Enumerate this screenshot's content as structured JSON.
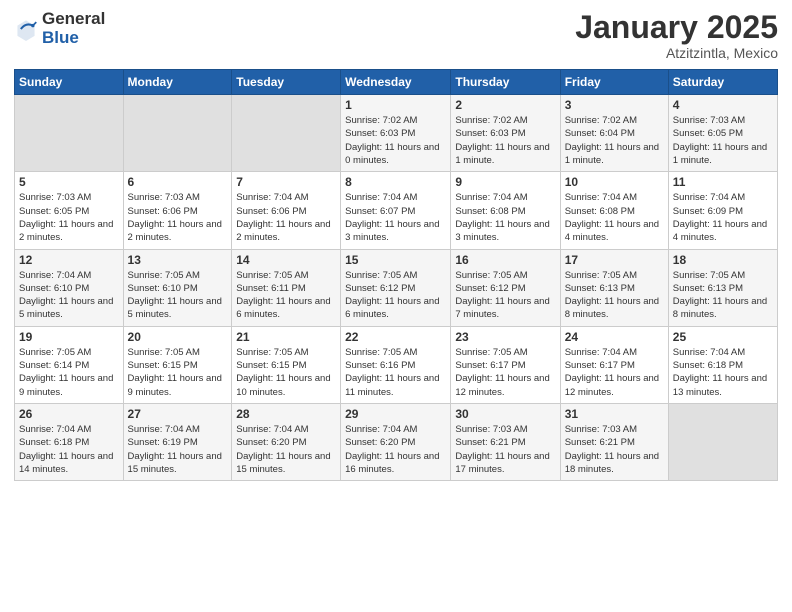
{
  "logo": {
    "general": "General",
    "blue": "Blue"
  },
  "title": "January 2025",
  "location": "Atzitzintla, Mexico",
  "days_of_week": [
    "Sunday",
    "Monday",
    "Tuesday",
    "Wednesday",
    "Thursday",
    "Friday",
    "Saturday"
  ],
  "weeks": [
    [
      null,
      null,
      null,
      {
        "day": 1,
        "sunrise": "7:02 AM",
        "sunset": "6:03 PM",
        "daylight": "11 hours and 0 minutes."
      },
      {
        "day": 2,
        "sunrise": "7:02 AM",
        "sunset": "6:03 PM",
        "daylight": "11 hours and 1 minute."
      },
      {
        "day": 3,
        "sunrise": "7:02 AM",
        "sunset": "6:04 PM",
        "daylight": "11 hours and 1 minute."
      },
      {
        "day": 4,
        "sunrise": "7:03 AM",
        "sunset": "6:05 PM",
        "daylight": "11 hours and 1 minute."
      }
    ],
    [
      {
        "day": 5,
        "sunrise": "7:03 AM",
        "sunset": "6:05 PM",
        "daylight": "11 hours and 2 minutes."
      },
      {
        "day": 6,
        "sunrise": "7:03 AM",
        "sunset": "6:06 PM",
        "daylight": "11 hours and 2 minutes."
      },
      {
        "day": 7,
        "sunrise": "7:04 AM",
        "sunset": "6:06 PM",
        "daylight": "11 hours and 2 minutes."
      },
      {
        "day": 8,
        "sunrise": "7:04 AM",
        "sunset": "6:07 PM",
        "daylight": "11 hours and 3 minutes."
      },
      {
        "day": 9,
        "sunrise": "7:04 AM",
        "sunset": "6:08 PM",
        "daylight": "11 hours and 3 minutes."
      },
      {
        "day": 10,
        "sunrise": "7:04 AM",
        "sunset": "6:08 PM",
        "daylight": "11 hours and 4 minutes."
      },
      {
        "day": 11,
        "sunrise": "7:04 AM",
        "sunset": "6:09 PM",
        "daylight": "11 hours and 4 minutes."
      }
    ],
    [
      {
        "day": 12,
        "sunrise": "7:04 AM",
        "sunset": "6:10 PM",
        "daylight": "11 hours and 5 minutes."
      },
      {
        "day": 13,
        "sunrise": "7:05 AM",
        "sunset": "6:10 PM",
        "daylight": "11 hours and 5 minutes."
      },
      {
        "day": 14,
        "sunrise": "7:05 AM",
        "sunset": "6:11 PM",
        "daylight": "11 hours and 6 minutes."
      },
      {
        "day": 15,
        "sunrise": "7:05 AM",
        "sunset": "6:12 PM",
        "daylight": "11 hours and 6 minutes."
      },
      {
        "day": 16,
        "sunrise": "7:05 AM",
        "sunset": "6:12 PM",
        "daylight": "11 hours and 7 minutes."
      },
      {
        "day": 17,
        "sunrise": "7:05 AM",
        "sunset": "6:13 PM",
        "daylight": "11 hours and 8 minutes."
      },
      {
        "day": 18,
        "sunrise": "7:05 AM",
        "sunset": "6:13 PM",
        "daylight": "11 hours and 8 minutes."
      }
    ],
    [
      {
        "day": 19,
        "sunrise": "7:05 AM",
        "sunset": "6:14 PM",
        "daylight": "11 hours and 9 minutes."
      },
      {
        "day": 20,
        "sunrise": "7:05 AM",
        "sunset": "6:15 PM",
        "daylight": "11 hours and 9 minutes."
      },
      {
        "day": 21,
        "sunrise": "7:05 AM",
        "sunset": "6:15 PM",
        "daylight": "11 hours and 10 minutes."
      },
      {
        "day": 22,
        "sunrise": "7:05 AM",
        "sunset": "6:16 PM",
        "daylight": "11 hours and 11 minutes."
      },
      {
        "day": 23,
        "sunrise": "7:05 AM",
        "sunset": "6:17 PM",
        "daylight": "11 hours and 12 minutes."
      },
      {
        "day": 24,
        "sunrise": "7:04 AM",
        "sunset": "6:17 PM",
        "daylight": "11 hours and 12 minutes."
      },
      {
        "day": 25,
        "sunrise": "7:04 AM",
        "sunset": "6:18 PM",
        "daylight": "11 hours and 13 minutes."
      }
    ],
    [
      {
        "day": 26,
        "sunrise": "7:04 AM",
        "sunset": "6:18 PM",
        "daylight": "11 hours and 14 minutes."
      },
      {
        "day": 27,
        "sunrise": "7:04 AM",
        "sunset": "6:19 PM",
        "daylight": "11 hours and 15 minutes."
      },
      {
        "day": 28,
        "sunrise": "7:04 AM",
        "sunset": "6:20 PM",
        "daylight": "11 hours and 15 minutes."
      },
      {
        "day": 29,
        "sunrise": "7:04 AM",
        "sunset": "6:20 PM",
        "daylight": "11 hours and 16 minutes."
      },
      {
        "day": 30,
        "sunrise": "7:03 AM",
        "sunset": "6:21 PM",
        "daylight": "11 hours and 17 minutes."
      },
      {
        "day": 31,
        "sunrise": "7:03 AM",
        "sunset": "6:21 PM",
        "daylight": "11 hours and 18 minutes."
      },
      null
    ]
  ]
}
